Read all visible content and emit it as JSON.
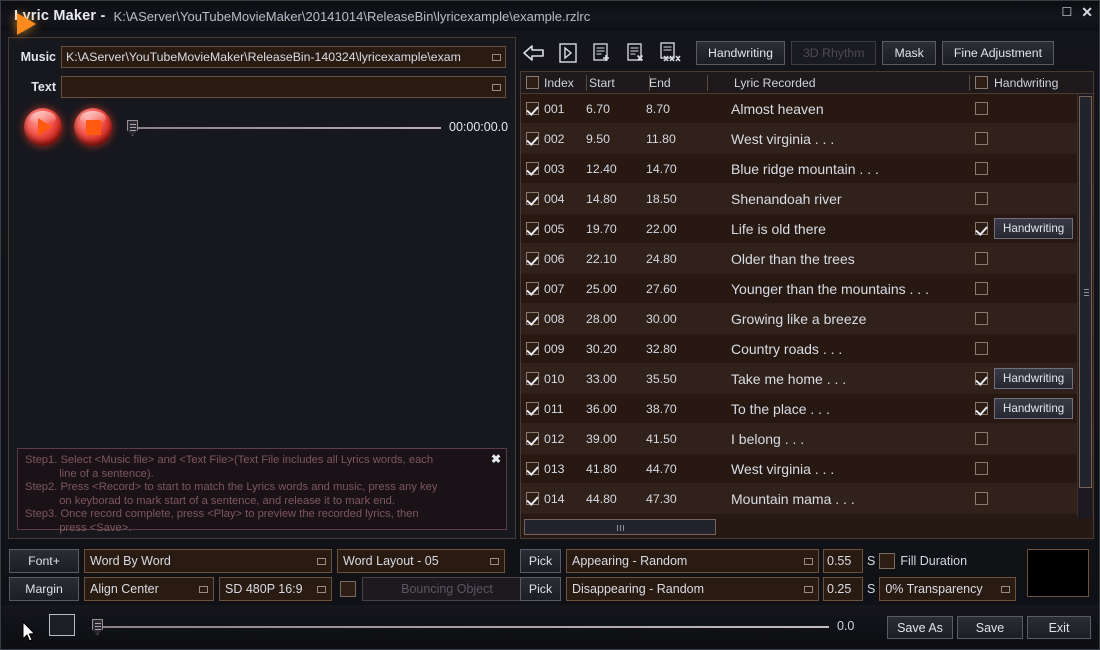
{
  "titlebar": {
    "app_title": "Lyric Maker -",
    "file_path": "K:\\AServer\\YouTubeMovieMaker\\20141014\\ReleaseBin\\lyricexample\\example.rzlrc",
    "restore_icon": "restore-icon",
    "close_icon": "close-icon"
  },
  "left": {
    "music_label": "Music",
    "music_value": "K:\\AServer\\YouTubeMovieMaker\\ReleaseBin-140324\\lyricexample\\exam",
    "text_label": "Text",
    "text_value": "",
    "play_icon": "play-icon",
    "stop_icon": "stop-icon",
    "time_display": "00:00:00.0",
    "help": {
      "close_label": "✖",
      "lines": [
        "Step1. Select <Music file> and <Text File>(Text File includes all Lyrics words, each",
        "           line of a sentence).",
        "Step2. Press <Record> to start to match the Lyrics words and music, press any key",
        "           on keyborad to mark start of a sentence, and release it to mark end.",
        "Step3. Once record complete, press <Play> to preview the recorded lyrics, then",
        "           press <Save>."
      ]
    }
  },
  "toolbar": {
    "icons": [
      {
        "name": "back-arrow-icon"
      },
      {
        "name": "play-in-frame-icon"
      },
      {
        "name": "document-add-icon"
      },
      {
        "name": "document-delete-icon"
      },
      {
        "name": "document-delete-all-icon"
      }
    ],
    "buttons": [
      {
        "label": "Handwriting",
        "disabled": false
      },
      {
        "label": "3D Rhythm",
        "disabled": true
      },
      {
        "label": "Mask",
        "disabled": false
      },
      {
        "label": "Fine Adjustment",
        "disabled": false
      }
    ]
  },
  "table": {
    "headers": {
      "select_all": false,
      "index": "Index",
      "start": "Start",
      "end": "End",
      "lyric": "Lyric Recorded",
      "handwriting_all": false,
      "handwriting": "Handwriting"
    },
    "rows": [
      {
        "checked": true,
        "index": "001",
        "start": "6.70",
        "end": "8.70",
        "lyric": "Almost heaven",
        "hw_checked": false,
        "hw_label": ""
      },
      {
        "checked": true,
        "index": "002",
        "start": "9.50",
        "end": "11.80",
        "lyric": "West virginia . . .",
        "hw_checked": false,
        "hw_label": ""
      },
      {
        "checked": true,
        "index": "003",
        "start": "12.40",
        "end": "14.70",
        "lyric": "Blue ridge mountain . . .",
        "hw_checked": false,
        "hw_label": ""
      },
      {
        "checked": true,
        "index": "004",
        "start": "14.80",
        "end": "18.50",
        "lyric": "Shenandoah river",
        "hw_checked": false,
        "hw_label": ""
      },
      {
        "checked": true,
        "index": "005",
        "start": "19.70",
        "end": "22.00",
        "lyric": "Life is old there",
        "hw_checked": true,
        "hw_label": "Handwriting"
      },
      {
        "checked": true,
        "index": "006",
        "start": "22.10",
        "end": "24.80",
        "lyric": "Older than the trees",
        "hw_checked": false,
        "hw_label": ""
      },
      {
        "checked": true,
        "index": "007",
        "start": "25.00",
        "end": "27.60",
        "lyric": "Younger than the mountains . . .",
        "hw_checked": false,
        "hw_label": ""
      },
      {
        "checked": true,
        "index": "008",
        "start": "28.00",
        "end": "30.00",
        "lyric": "Growing like a breeze",
        "hw_checked": false,
        "hw_label": ""
      },
      {
        "checked": true,
        "index": "009",
        "start": "30.20",
        "end": "32.80",
        "lyric": "Country roads . . .",
        "hw_checked": false,
        "hw_label": ""
      },
      {
        "checked": true,
        "index": "010",
        "start": "33.00",
        "end": "35.50",
        "lyric": "Take me home . . .",
        "hw_checked": true,
        "hw_label": "Handwriting"
      },
      {
        "checked": true,
        "index": "011",
        "start": "36.00",
        "end": "38.70",
        "lyric": "To the place . . .",
        "hw_checked": true,
        "hw_label": "Handwriting"
      },
      {
        "checked": true,
        "index": "012",
        "start": "39.00",
        "end": "41.50",
        "lyric": "I belong . . .",
        "hw_checked": false,
        "hw_label": ""
      },
      {
        "checked": true,
        "index": "013",
        "start": "41.80",
        "end": "44.70",
        "lyric": "West virginia . . .",
        "hw_checked": false,
        "hw_label": ""
      },
      {
        "checked": true,
        "index": "014",
        "start": "44.80",
        "end": "47.30",
        "lyric": "Mountain mama . . .",
        "hw_checked": false,
        "hw_label": ""
      }
    ]
  },
  "options": {
    "font_plus": "Font+",
    "margin": "Margin",
    "word_mode": "Word By Word",
    "word_layout": "Word Layout - 05",
    "align": "Align Center",
    "resolution": "SD 480P 16:9",
    "bouncing_checked": false,
    "bouncing_object": "Bouncing Object",
    "pick_appearing": "Pick",
    "pick_disappearing": "Pick",
    "appearing": "Appearing - Random",
    "disappearing": "Disappearing - Random",
    "appearing_time": "0.55",
    "disappearing_time": "0.25",
    "seconds_unit_1": "S",
    "seconds_unit_2": "S",
    "fill_duration_checked": false,
    "fill_duration": "Fill Duration",
    "transparency": "0% Transparency",
    "color_swatch": "#000000"
  },
  "bottom": {
    "play_icon": "play-icon",
    "stop_icon": "stop-icon",
    "position": "0.0",
    "save_as": "Save As",
    "save": "Save",
    "exit": "Exit"
  }
}
